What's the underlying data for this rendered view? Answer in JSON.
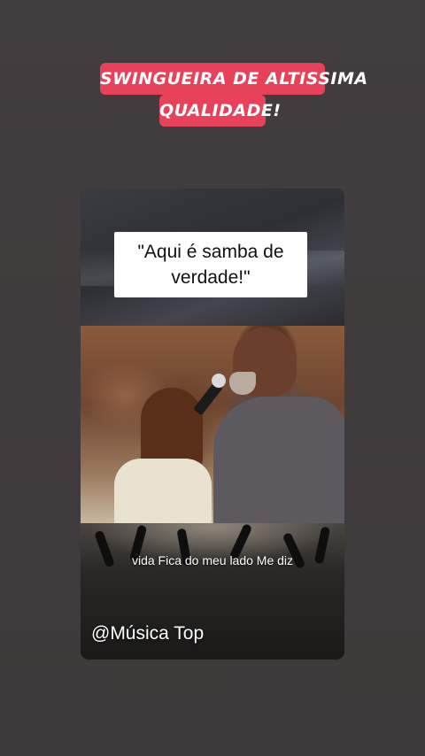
{
  "sticker": {
    "line1": "SWINGUEIRA DE ALTISSIMA",
    "line2": "QUALIDADE!"
  },
  "video": {
    "quote": "\"Aqui é samba de verdade!\"",
    "subtitle": "vida Fica do meu lado Me diz",
    "watermark": "@Música Top"
  },
  "colors": {
    "sticker_bg": "#e8425a",
    "page_bg": "#403b3c"
  }
}
